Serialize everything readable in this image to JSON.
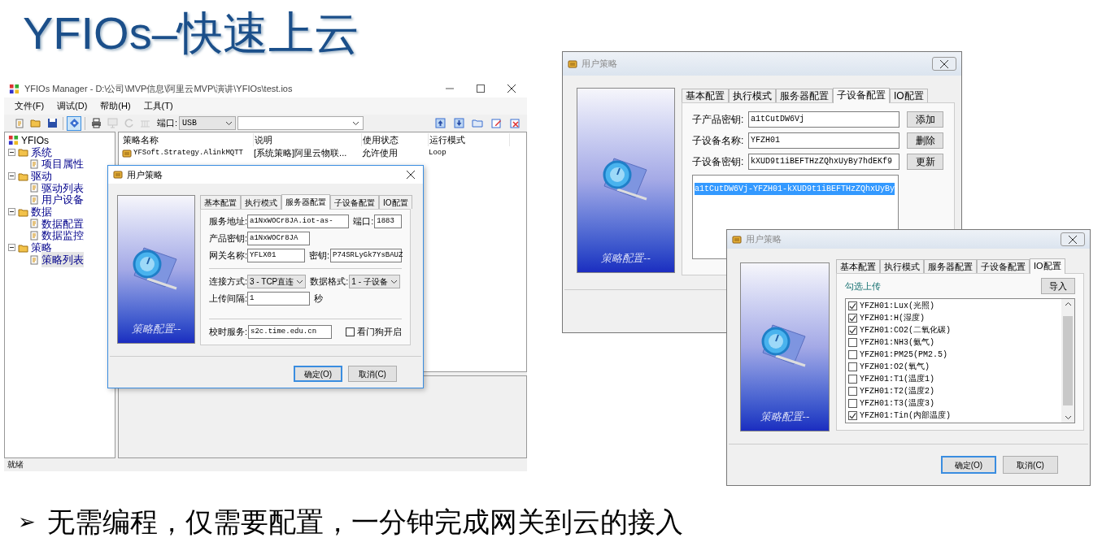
{
  "slide_title": "YFIOs–快速上云",
  "main_window": {
    "title": "YFIOs Manager - D:\\公司\\MVP信息\\阿里云MVP\\演讲\\YFIOs\\test.ios",
    "menu": [
      "文件(F)",
      "调试(D)",
      "帮助(H)",
      "工具(T)"
    ],
    "toolbar": {
      "left": [
        {
          "pressed": false,
          "disabled": false
        },
        {
          "pressed": false,
          "disabled": false
        },
        {
          "pressed": false,
          "disabled": false
        },
        {
          "pressed": true,
          "disabled": false
        },
        {
          "pressed": false,
          "disabled": false
        },
        {
          "pressed": false,
          "disabled": true
        },
        {
          "pressed": false,
          "disabled": true
        },
        {
          "pressed": false,
          "disabled": true
        }
      ],
      "port_label": "端口:",
      "port_value": "USB"
    },
    "tree": {
      "label": "YFIOs",
      "children": [
        {
          "label": "系统",
          "expanded": true,
          "children": [
            {
              "label": "项目属性",
              "selected": false
            }
          ]
        },
        {
          "label": "驱动",
          "expanded": true,
          "children": [
            {
              "label": "驱动列表",
              "selected": false
            },
            {
              "label": "用户设备",
              "selected": false
            }
          ]
        },
        {
          "label": "数据",
          "expanded": true,
          "children": [
            {
              "label": "数据配置",
              "selected": false
            },
            {
              "label": "数据监控",
              "selected": false
            }
          ]
        },
        {
          "label": "策略",
          "expanded": true,
          "children": [
            {
              "label": "策略列表",
              "selected": true
            }
          ]
        }
      ]
    },
    "table": {
      "columns": [
        "策略名称",
        "说明",
        "使用状态",
        "运行模式"
      ],
      "rows": [
        [
          "YFSoft.Strategy.AlinkMQTT",
          "[系统策略]阿里云物联...",
          "允许使用",
          "Loop"
        ]
      ]
    },
    "status_bar": "就绪"
  },
  "dialogs": [
    {
      "kind": "server",
      "title": "用户策略",
      "active": true,
      "image_caption": "策略配置--",
      "tabs": [
        {
          "label": "基本配置",
          "selected": false
        },
        {
          "label": "执行模式",
          "selected": false
        },
        {
          "label": "服务器配置",
          "selected": true
        },
        {
          "label": "子设备配置",
          "selected": false
        },
        {
          "label": "IO配置",
          "selected": false
        }
      ],
      "fields": [
        {
          "label": "服务地址:",
          "value": "a1NxWOCr8JA.iot-as-"
        },
        {
          "label": "端口:",
          "value": "1883"
        },
        {
          "label": "产品密钥:",
          "value": "a1NxWOCr8JA"
        },
        {
          "label": "网关名称:",
          "value": "YFLX01"
        },
        {
          "label": "密钥:",
          "value": "P74SRLyGk7YsBAUZ"
        }
      ],
      "selects": [
        {
          "label": "连接方式:",
          "value": "3 - TCP直连"
        },
        {
          "label": "数据格式:",
          "value": "1 - 子设备"
        }
      ],
      "interval": {
        "label": "上传间隔:",
        "value": "1",
        "unit": "秒"
      },
      "time_server": {
        "label": "校时服务:",
        "value": "s2c.time.edu.cn"
      },
      "watchdog": {
        "label": "看门狗开启",
        "checked": false
      },
      "buttons": [
        {
          "label": "确定(O)",
          "default": true
        },
        {
          "label": "取消(C)",
          "default": false
        }
      ]
    },
    {
      "kind": "subdevice",
      "title": "用户策略",
      "active": false,
      "image_caption": "策略配置--",
      "tabs": [
        {
          "label": "基本配置",
          "selected": false
        },
        {
          "label": "执行模式",
          "selected": false
        },
        {
          "label": "服务器配置",
          "selected": false
        },
        {
          "label": "子设备配置",
          "selected": true
        },
        {
          "label": "IO配置",
          "selected": false
        }
      ],
      "fields": [
        {
          "label": "子产品密钥:",
          "value": "a1tCutDW6Vj",
          "button": "添加"
        },
        {
          "label": "子设备名称:",
          "value": "YFZH01",
          "button": "删除"
        },
        {
          "label": "子设备密钥:",
          "value": "kXUD9t1iBEFTHzZQhxUyBy7hdEKf9",
          "button": "更新"
        }
      ],
      "list": [
        {
          "text": "a1tCutDW6Vj-YFZH01-kXUD9t1iBEFTHzZQhxUyBy",
          "selected": true
        }
      ]
    },
    {
      "kind": "io",
      "title": "用户策略",
      "active": false,
      "image_caption": "策略配置--",
      "tabs": [
        {
          "label": "基本配置",
          "selected": false
        },
        {
          "label": "执行模式",
          "selected": false
        },
        {
          "label": "服务器配置",
          "selected": false
        },
        {
          "label": "子设备配置",
          "selected": false
        },
        {
          "label": "IO配置",
          "selected": true
        }
      ],
      "heading": "勾选上传",
      "import_button": "导入",
      "items": [
        {
          "text": "YFZH01:Lux(光照)",
          "checked": true
        },
        {
          "text": "YFZH01:H(湿度)",
          "checked": true
        },
        {
          "text": "YFZH01:CO2(二氧化碳)",
          "checked": true
        },
        {
          "text": "YFZH01:NH3(氨气)",
          "checked": false
        },
        {
          "text": "YFZH01:PM25(PM2.5)",
          "checked": false
        },
        {
          "text": "YFZH01:O2(氧气)",
          "checked": false
        },
        {
          "text": "YFZH01:T1(温度1)",
          "checked": false
        },
        {
          "text": "YFZH01:T2(温度2)",
          "checked": false
        },
        {
          "text": "YFZH01:T3(温度3)",
          "checked": false
        },
        {
          "text": "YFZH01:Tin(内部温度)",
          "checked": true
        }
      ],
      "buttons": [
        {
          "label": "确定(O)",
          "default": true
        },
        {
          "label": "取消(C)",
          "default": false
        }
      ]
    }
  ],
  "bullet": {
    "marker": "➢",
    "text": "无需编程，仅需要配置，一分钟完成网关到云的接入"
  }
}
